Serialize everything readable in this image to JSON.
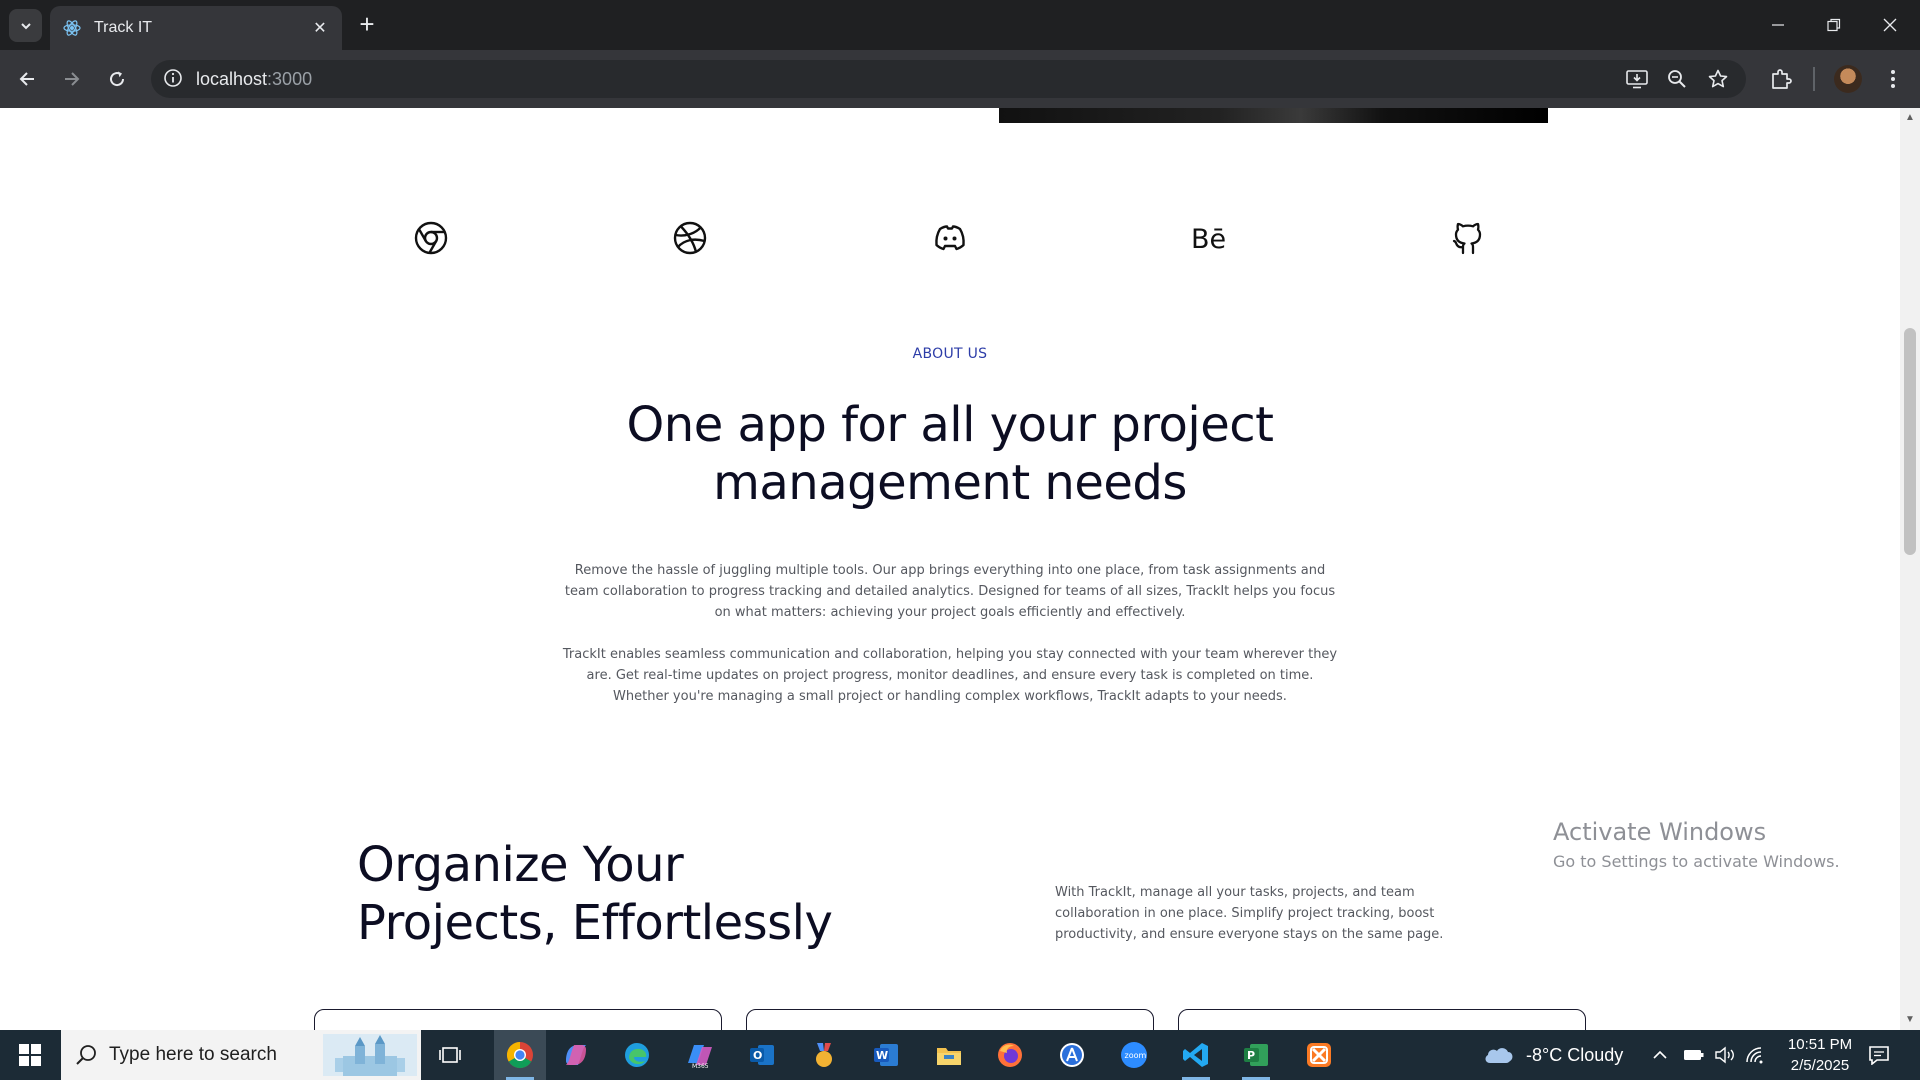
{
  "browser": {
    "tab_title": "Track IT",
    "url_host": "localhost",
    "url_port": ":3000"
  },
  "page": {
    "brand_icons": [
      "chrome-icon",
      "dribbble-icon",
      "discord-icon",
      "behance-icon",
      "github-icon"
    ],
    "about": {
      "eyebrow": "ABOUT US",
      "headline_line1": "One app for all your project",
      "headline_line2": "management needs",
      "paragraph1": "Remove the hassle of juggling multiple tools. Our app brings everything into one place, from task assignments and team collaboration to progress tracking and detailed analytics. Designed for teams of all sizes, TrackIt helps you focus on what matters: achieving your project goals efficiently and effectively.",
      "paragraph2": "TrackIt enables seamless communication and collaboration, helping you stay connected with your team wherever they are. Get real-time updates on project progress, monitor deadlines, and ensure every task is completed on time. Whether you're managing a small project or handling complex workflows, TrackIt adapts to your needs."
    },
    "organize": {
      "title_line1": "Organize Your",
      "title_line2": "Projects, Effortlessly",
      "text": "With TrackIt, manage all your tasks, projects, and team collaboration in one place. Simplify project tracking, boost productivity, and ensure everyone stays on the same page."
    }
  },
  "watermark": {
    "line1": "Activate Windows",
    "line2": "Go to Settings to activate Windows."
  },
  "taskbar": {
    "search_placeholder": "Type here to search",
    "weather": "-8°C  Cloudy",
    "time": "10:51 PM",
    "date": "2/5/2025"
  }
}
